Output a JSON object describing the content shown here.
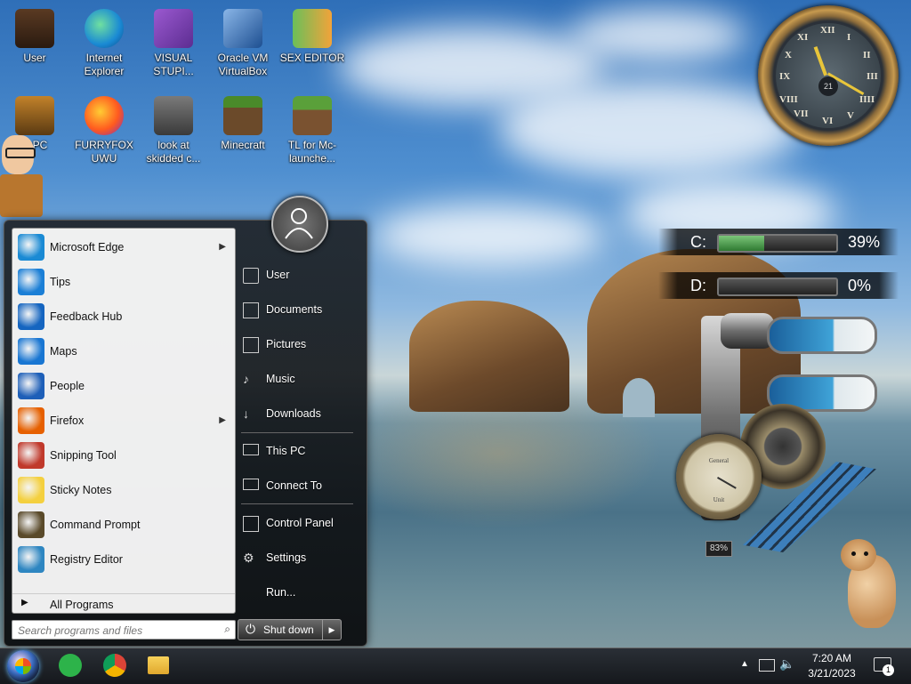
{
  "desktop": {
    "icons": [
      {
        "label": "User"
      },
      {
        "label": "Internet Explorer"
      },
      {
        "label": "VISUAL STUPI..."
      },
      {
        "label": "Oracle VM VirtualBox"
      },
      {
        "label": "SEX EDITOR"
      },
      {
        "label": "is PC"
      },
      {
        "label": "FURRYFOX UWU"
      },
      {
        "label": "look at skidded c..."
      },
      {
        "label": "Minecraft"
      },
      {
        "label": "TL for Mc-launche..."
      }
    ]
  },
  "clock_widget": {
    "numerals": [
      "XII",
      "I",
      "II",
      "III",
      "IIII",
      "V",
      "VI",
      "VII",
      "VIII",
      "IX",
      "X",
      "XI"
    ],
    "date": "21"
  },
  "drives": [
    {
      "label": "C:",
      "percent_text": "39%",
      "percent": 39
    },
    {
      "label": "D:",
      "percent_text": "0%",
      "percent": 0
    }
  ],
  "gadget": {
    "gauge_top": "General",
    "gauge_bottom": "Unit",
    "cpu_text": "83%"
  },
  "start_menu": {
    "apps": [
      {
        "label": "Microsoft Edge",
        "submenu": true,
        "icon": "edge-icon",
        "color": "#1a8ad4"
      },
      {
        "label": "Tips",
        "submenu": false,
        "icon": "lightbulb-icon",
        "color": "#1b7fd6"
      },
      {
        "label": "Feedback Hub",
        "submenu": false,
        "icon": "feedback-icon",
        "color": "#1565c0"
      },
      {
        "label": "Maps",
        "submenu": false,
        "icon": "map-pin-icon",
        "color": "#1976d2"
      },
      {
        "label": "People",
        "submenu": false,
        "icon": "people-icon",
        "color": "#1e5fb8"
      },
      {
        "label": "Firefox",
        "submenu": true,
        "icon": "firefox-icon",
        "color": "#e66000"
      },
      {
        "label": "Snipping Tool",
        "submenu": false,
        "icon": "scissors-icon",
        "color": "#c0392b"
      },
      {
        "label": "Sticky Notes",
        "submenu": false,
        "icon": "sticky-note-icon",
        "color": "#f4d03f"
      },
      {
        "label": "Command Prompt",
        "submenu": false,
        "icon": "terminal-icon",
        "color": "#5a4a2a"
      },
      {
        "label": "Registry Editor",
        "submenu": false,
        "icon": "registry-icon",
        "color": "#2e86c1"
      }
    ],
    "all_programs": "All Programs",
    "search_placeholder": "Search programs and files",
    "right_items": [
      {
        "label": "User",
        "icon": "user-folder-icon"
      },
      {
        "label": "Documents",
        "icon": "documents-icon"
      },
      {
        "label": "Pictures",
        "icon": "pictures-icon"
      },
      {
        "label": "Music",
        "icon": "music-icon"
      },
      {
        "label": "Downloads",
        "icon": "download-icon"
      },
      {
        "label": "This PC",
        "icon": "computer-icon"
      },
      {
        "label": "Connect To",
        "icon": "connect-icon"
      },
      {
        "label": "Control Panel",
        "icon": "control-panel-icon"
      },
      {
        "label": "Settings",
        "icon": "gear-icon"
      },
      {
        "label": "Run...",
        "icon": "run-icon"
      }
    ],
    "shutdown_label": "Shut down"
  },
  "taskbar": {
    "time": "7:20 AM",
    "date": "3/21/2023",
    "notification_count": "1"
  },
  "colors": {
    "drive_fill": "#4caf50",
    "tube_blue": "#2a8fcf",
    "taskbar": "#1e2228"
  }
}
